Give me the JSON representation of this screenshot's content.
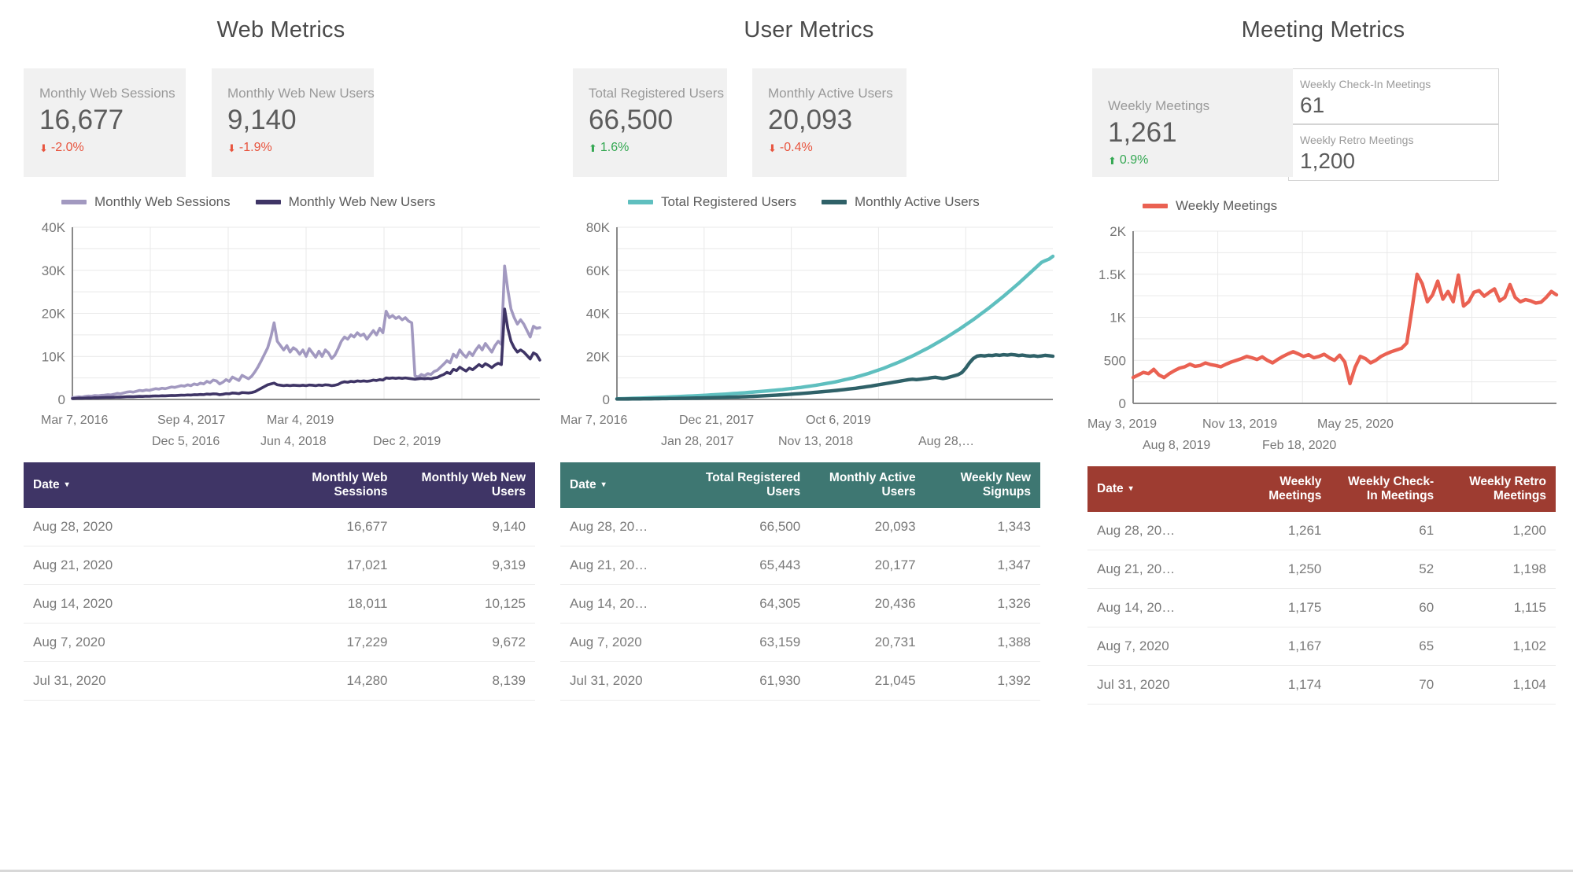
{
  "panels": [
    {
      "title": "Web Metrics",
      "scorecards": [
        {
          "label": "Monthly Web Sessions",
          "value": "16,677",
          "delta": "-2.0%",
          "direction": "down",
          "arrow": "⬇"
        },
        {
          "label": "Monthly Web New Users",
          "value": "9,140",
          "delta": "-1.9%",
          "direction": "down",
          "arrow": "⬇"
        }
      ],
      "legend": [
        {
          "label": "Monthly Web Sessions",
          "color": "#a299c0"
        },
        {
          "label": "Monthly Web New Users",
          "color": "#3f3566"
        }
      ],
      "table": {
        "columns": [
          "Date",
          "Monthly Web Sessions",
          "Monthly Web New Users"
        ],
        "sort_column": "Date",
        "sort_caret": "▾",
        "rows": [
          [
            "Aug 28, 2020",
            "16,677",
            "9,140"
          ],
          [
            "Aug 21, 2020",
            "17,021",
            "9,319"
          ],
          [
            "Aug 14, 2020",
            "18,011",
            "10,125"
          ],
          [
            "Aug 7, 2020",
            "17,229",
            "9,672"
          ],
          [
            "Jul 31, 2020",
            "14,280",
            "8,139"
          ]
        ]
      }
    },
    {
      "title": "User Metrics",
      "scorecards": [
        {
          "label": "Total Registered Users",
          "value": "66,500",
          "delta": "1.6%",
          "direction": "up",
          "arrow": "⬆"
        },
        {
          "label": "Monthly Active Users",
          "value": "20,093",
          "delta": "-0.4%",
          "direction": "down",
          "arrow": "⬇"
        }
      ],
      "legend": [
        {
          "label": "Total Registered Users",
          "color": "#5fbfbf"
        },
        {
          "label": "Monthly Active Users",
          "color": "#2f6168"
        }
      ],
      "table": {
        "columns": [
          "Date",
          "Total Registered Users",
          "Monthly Active Users",
          "Weekly New Signups"
        ],
        "sort_column": "Date",
        "sort_caret": "▾",
        "rows": [
          [
            "Aug 28, 20…",
            "66,500",
            "20,093",
            "1,343"
          ],
          [
            "Aug 21, 20…",
            "65,443",
            "20,177",
            "1,347"
          ],
          [
            "Aug 14, 20…",
            "64,305",
            "20,436",
            "1,326"
          ],
          [
            "Aug 7, 2020",
            "63,159",
            "20,731",
            "1,388"
          ],
          [
            "Jul 31, 2020",
            "61,930",
            "21,045",
            "1,392"
          ]
        ]
      }
    },
    {
      "title": "Meeting Metrics",
      "scorecards": [
        {
          "label": "Weekly Meetings",
          "value": "1,261",
          "delta": "0.9%",
          "direction": "up",
          "arrow": "⬆"
        }
      ],
      "mini_cards": [
        {
          "label": "Weekly Check-In Meetings",
          "value": "61"
        },
        {
          "label": "Weekly Retro Meetings",
          "value": "1,200"
        }
      ],
      "legend": [
        {
          "label": "Weekly Meetings",
          "color": "#ea6152"
        }
      ],
      "table": {
        "columns": [
          "Date",
          "Weekly Meetings",
          "Weekly Check-In Meetings",
          "Weekly Retro Meetings"
        ],
        "sort_column": "Date",
        "sort_caret": "▾",
        "rows": [
          [
            "Aug 28, 20…",
            "1,261",
            "61",
            "1,200"
          ],
          [
            "Aug 21, 20…",
            "1,250",
            "52",
            "1,198"
          ],
          [
            "Aug 14, 20…",
            "1,175",
            "60",
            "1,115"
          ],
          [
            "Aug 7, 2020",
            "1,167",
            "65",
            "1,102"
          ],
          [
            "Jul 31, 2020",
            "1,174",
            "70",
            "1,104"
          ]
        ]
      }
    }
  ],
  "chart_data": [
    {
      "type": "line",
      "title": "Web Metrics",
      "xlabel": "",
      "ylabel": "",
      "ylim": [
        0,
        40000
      ],
      "ytick_labels": [
        "0",
        "10K",
        "20K",
        "30K",
        "40K"
      ],
      "ytick_values": [
        0,
        10000,
        20000,
        30000,
        40000
      ],
      "grid": true,
      "legend_position": "top",
      "xtick_labels": [
        "Mar 7, 2016",
        "Dec 5, 2016",
        "Sep 4, 2017",
        "Jun 4, 2018",
        "Mar 4, 2019",
        "Dec 2, 2019"
      ],
      "series": [
        {
          "name": "Monthly Web Sessions",
          "color": "#a299c0",
          "values": [
            400,
            500,
            600,
            550,
            700,
            800,
            750,
            900,
            850,
            950,
            1000,
            1100,
            1050,
            1200,
            1400,
            1300,
            1500,
            1700,
            1800,
            1700,
            1900,
            2100,
            2000,
            2200,
            2100,
            2300,
            2500,
            2400,
            2600,
            2500,
            2700,
            2900,
            2800,
            3000,
            3200,
            3100,
            3400,
            3200,
            3600,
            3400,
            3800,
            3600,
            4200,
            3900,
            4500,
            4300,
            3600,
            4000,
            4600,
            4200,
            5200,
            4800,
            4400,
            5600,
            5200,
            4800,
            5400,
            6400,
            7600,
            9000,
            10500,
            12000,
            14500,
            17800,
            13500,
            12500,
            11500,
            12500,
            11000,
            12000,
            11500,
            10500,
            11500,
            10000,
            11800,
            10800,
            9800,
            11200,
            10000,
            11500,
            10800,
            9500,
            10300,
            11800,
            13500,
            14500,
            14000,
            15000,
            14500,
            15500,
            14800,
            15200,
            14000,
            15000,
            16000,
            15000,
            16500,
            15500,
            20500,
            19000,
            19500,
            18800,
            19200,
            18500,
            19000,
            18200,
            17800,
            5500,
            5200,
            5800,
            5500,
            6000,
            5800,
            6500,
            6800,
            7500,
            8200,
            9000,
            8500,
            10500,
            9800,
            11500,
            10500,
            9800,
            11000,
            10200,
            11500,
            12500,
            11500,
            13000,
            12000,
            11000,
            12500,
            13500,
            12800,
            31000,
            25500,
            21000,
            19000,
            17500,
            18500,
            17500,
            16000,
            14500,
            17000,
            16500,
            16677
          ],
          "peak_value": 31000
        },
        {
          "name": "Monthly Web New Users",
          "color": "#3f3566",
          "values": [
            200,
            250,
            300,
            280,
            320,
            350,
            340,
            400,
            380,
            420,
            450,
            480,
            460,
            500,
            550,
            530,
            580,
            620,
            650,
            630,
            680,
            720,
            700,
            750,
            730,
            780,
            820,
            800,
            850,
            830,
            880,
            920,
            900,
            950,
            1000,
            980,
            1050,
            1020,
            1100,
            1080,
            1150,
            1120,
            1250,
            1200,
            1300,
            1280,
            1100,
            1200,
            1350,
            1300,
            1500,
            1450,
            1350,
            1600,
            1550,
            1500,
            1600,
            1800,
            2200,
            2600,
            3000,
            3400,
            3600,
            3800,
            3400,
            3300,
            3200,
            3300,
            3200,
            3300,
            3250,
            3200,
            3300,
            3200,
            3350,
            3300,
            3200,
            3350,
            3250,
            3400,
            3350,
            3200,
            3300,
            3500,
            3900,
            4100,
            4000,
            4200,
            4100,
            4300,
            4200,
            4300,
            4200,
            4300,
            4500,
            4400,
            4600,
            4500,
            5000,
            4900,
            5000,
            4900,
            5000,
            4900,
            5000,
            4900,
            4800,
            4700,
            4800,
            4900,
            4800,
            4900,
            4800,
            5000,
            5100,
            5500,
            5800,
            6300,
            6000,
            7000,
            6700,
            7500,
            7000,
            6600,
            7300,
            6900,
            7500,
            8100,
            7600,
            8300,
            7900,
            7400,
            8000,
            8400,
            8100,
            21000,
            16500,
            13500,
            12000,
            11000,
            11500,
            11000,
            10200,
            9400,
            10800,
            10400,
            9140
          ],
          "peak_value": 21000
        }
      ]
    },
    {
      "type": "line",
      "title": "User Metrics",
      "xlabel": "",
      "ylabel": "",
      "ylim": [
        0,
        80000
      ],
      "ytick_labels": [
        "0",
        "20K",
        "40K",
        "60K",
        "80K"
      ],
      "ytick_values": [
        0,
        20000,
        40000,
        60000,
        80000
      ],
      "grid": true,
      "legend_position": "top",
      "xtick_labels": [
        "Mar 7, 2016",
        "Jan 28, 2017",
        "Dec 21, 2017",
        "Nov 13, 2018",
        "Oct 6, 2019",
        "Aug 28,…"
      ],
      "series": [
        {
          "name": "Total Registered Users",
          "color": "#5fbfbf",
          "values": [
            300,
            350,
            400,
            450,
            500,
            560,
            620,
            680,
            740,
            800,
            870,
            940,
            1010,
            1080,
            1150,
            1230,
            1310,
            1390,
            1470,
            1550,
            1640,
            1730,
            1820,
            1910,
            2000,
            2100,
            2200,
            2300,
            2400,
            2500,
            2620,
            2740,
            2860,
            2980,
            3100,
            3240,
            3380,
            3520,
            3660,
            3800,
            3960,
            4120,
            4280,
            4440,
            4600,
            4800,
            5000,
            5200,
            5400,
            5600,
            5850,
            6100,
            6350,
            6600,
            6900,
            7200,
            7500,
            7800,
            8100,
            8500,
            8900,
            9300,
            9700,
            10100,
            10600,
            11100,
            11600,
            12100,
            12700,
            13300,
            13900,
            14500,
            15200,
            15900,
            16600,
            17300,
            18100,
            18900,
            19700,
            20500,
            21400,
            22300,
            23200,
            24100,
            25100,
            26100,
            27100,
            28100,
            29200,
            30300,
            31400,
            32500,
            33700,
            34900,
            36100,
            37300,
            38600,
            39900,
            41200,
            42500,
            43900,
            45300,
            46700,
            48100,
            49600,
            51100,
            52600,
            54100,
            55700,
            57300,
            58900,
            60500,
            62100,
            63700,
            64500,
            65200,
            66500
          ],
          "final_value": 66500
        },
        {
          "name": "Monthly Active Users",
          "color": "#2f6168",
          "values": [
            200,
            210,
            220,
            230,
            240,
            250,
            260,
            280,
            300,
            320,
            340,
            360,
            380,
            400,
            420,
            450,
            480,
            510,
            540,
            570,
            600,
            640,
            680,
            720,
            760,
            800,
            850,
            900,
            950,
            1000,
            1060,
            1120,
            1180,
            1240,
            1300,
            1380,
            1460,
            1540,
            1620,
            1700,
            1800,
            1900,
            2000,
            2100,
            2200,
            2320,
            2440,
            2560,
            2680,
            2800,
            2950,
            3100,
            3250,
            3400,
            3560,
            3720,
            3880,
            4040,
            4200,
            4400,
            4600,
            4800,
            5000,
            5200,
            5450,
            5700,
            5950,
            6200,
            6500,
            6800,
            7100,
            7400,
            7700,
            8000,
            8300,
            8600,
            8900,
            9200,
            9400,
            9200,
            9400,
            9600,
            9800,
            10100,
            10300,
            10000,
            9700,
            10000,
            10500,
            11000,
            11500,
            12500,
            14500,
            17000,
            19000,
            20100,
            20400,
            20200,
            20500,
            20400,
            20700,
            20500,
            20800,
            20600,
            20900,
            20700,
            20400,
            20600,
            20300,
            20100,
            20300,
            20000,
            20200,
            20500,
            20300,
            20093
          ],
          "final_value": 20093
        }
      ]
    },
    {
      "type": "line",
      "title": "Meeting Metrics",
      "xlabel": "",
      "ylabel": "",
      "ylim": [
        0,
        2000
      ],
      "ytick_labels": [
        "0",
        "500",
        "1K",
        "1.5K",
        "2K"
      ],
      "ytick_values": [
        0,
        500,
        1000,
        1500,
        2000
      ],
      "grid": true,
      "legend_position": "top",
      "xtick_labels": [
        "May 3, 2019",
        "Aug 8, 2019",
        "Nov 13, 2019",
        "Feb 18, 2020",
        "May 25, 2020"
      ],
      "series": [
        {
          "name": "Weekly Meetings",
          "color": "#ea6152",
          "values": [
            300,
            330,
            360,
            345,
            395,
            330,
            300,
            345,
            380,
            410,
            425,
            455,
            430,
            440,
            470,
            450,
            440,
            425,
            455,
            480,
            500,
            520,
            545,
            530,
            510,
            540,
            500,
            470,
            510,
            545,
            575,
            600,
            575,
            545,
            565,
            530,
            545,
            570,
            530,
            500,
            560,
            480,
            230,
            420,
            545,
            520,
            470,
            500,
            545,
            575,
            600,
            620,
            640,
            700,
            1090,
            1500,
            1390,
            1180,
            1260,
            1420,
            1210,
            1300,
            1180,
            1490,
            1130,
            1180,
            1290,
            1310,
            1245,
            1290,
            1330,
            1190,
            1230,
            1380,
            1230,
            1180,
            1205,
            1190,
            1165,
            1175,
            1230,
            1300,
            1261
          ],
          "peak_value": 1500
        }
      ]
    }
  ]
}
